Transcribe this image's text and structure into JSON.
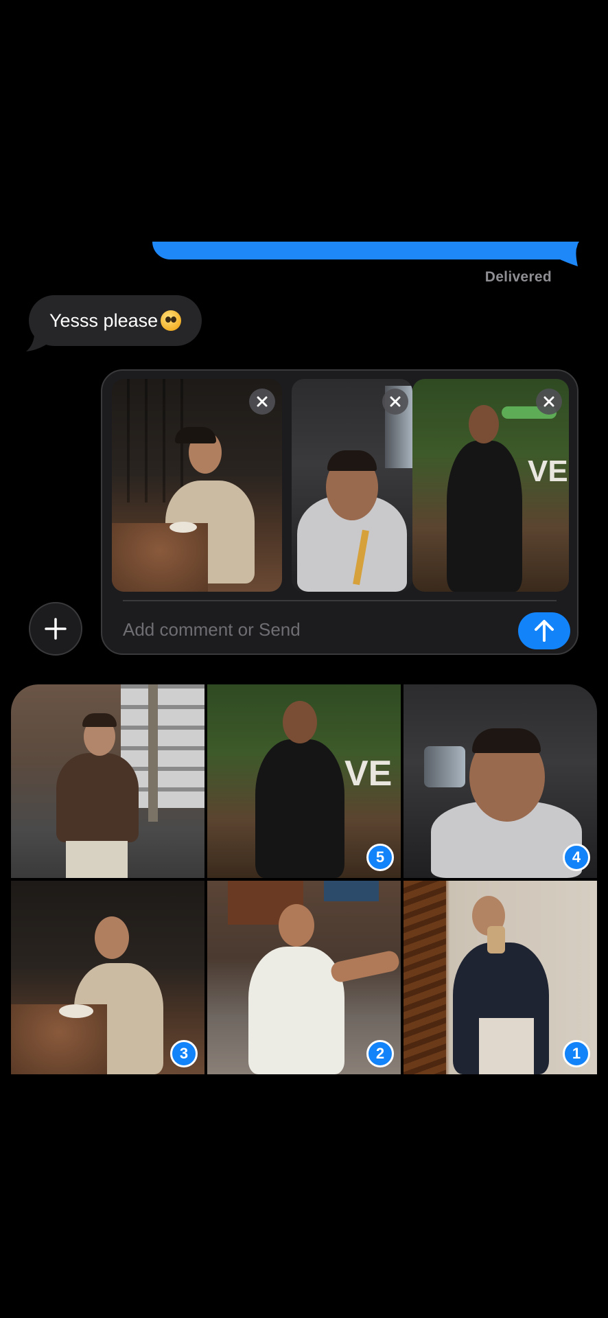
{
  "thread": {
    "delivered_label": "Delivered",
    "received_message": "Yesss please"
  },
  "composer": {
    "placeholder": "Add comment or Send",
    "attachments": [
      {
        "description": "man in beige sweater at restaurant table"
      },
      {
        "description": "man in grey hoodie selfie in car"
      },
      {
        "description": "man in black shirt in garden"
      }
    ]
  },
  "photo_grid": {
    "photos": [
      {
        "description": "man in brown leather jacket on street",
        "selected": false
      },
      {
        "description": "man in black shirt in garden",
        "selected": true,
        "order": "5"
      },
      {
        "description": "man in grey hoodie in car",
        "selected": true,
        "order": "4"
      },
      {
        "description": "man in beige sweater at restaurant",
        "selected": true,
        "order": "3"
      },
      {
        "description": "man in white tee on sofa",
        "selected": true,
        "order": "2"
      },
      {
        "description": "man in navy shirt mirror selfie",
        "selected": true,
        "order": "1"
      }
    ]
  },
  "colors": {
    "accent": "#1283f8",
    "received_bubble": "#262629",
    "background": "#000000"
  }
}
